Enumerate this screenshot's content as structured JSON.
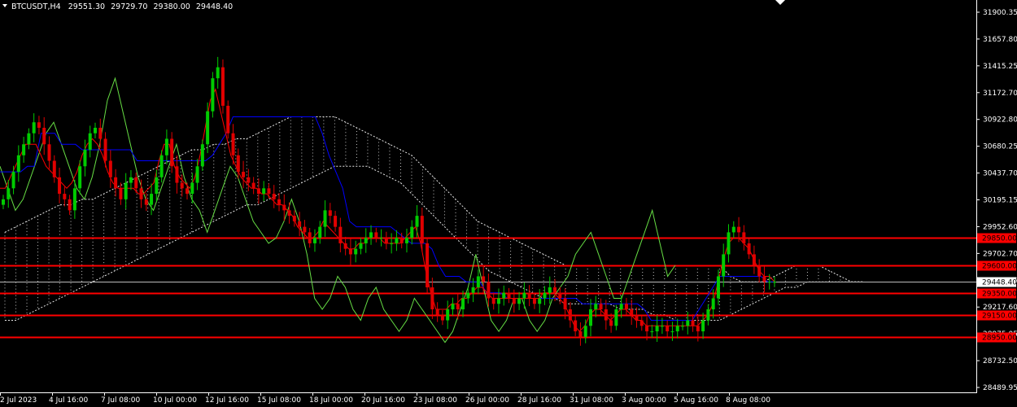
{
  "header": {
    "symbol": "BTCUSDT,H4",
    "open": "29551.30",
    "high": "29729.70",
    "low": "29380.00",
    "close": "29448.40"
  },
  "colors": {
    "background": "#000000",
    "bull_candle": "#00cc00",
    "bear_candle": "#e00000",
    "level_line": "#ff0000",
    "kijun": "#0000ff",
    "tenkan": "#ff0000",
    "chikou": "#66dd44",
    "cloud": "#e6e6e6",
    "axis": "#ffffff"
  },
  "chart_data": {
    "type": "candlestick",
    "y_ticks": [
      "31900.35",
      "31657.80",
      "31415.25",
      "31172.70",
      "30922.80",
      "30680.25",
      "30437.70",
      "30195.15",
      "29952.60",
      "29702.70",
      "29460.15",
      "29217.60",
      "28975.05",
      "28732.50",
      "28489.95"
    ],
    "ylim": [
      28489.95,
      31900.35
    ],
    "x_ticks": [
      "2 Jul 2023",
      "4 Jul 16:00",
      "7 Jul 08:00",
      "10 Jul 00:00",
      "12 Jul 16:00",
      "15 Jul 08:00",
      "18 Jul 00:00",
      "20 Jul 16:00",
      "23 Jul 08:00",
      "26 Jul 00:00",
      "28 Jul 16:00",
      "31 Jul 08:00",
      "3 Aug 00:00",
      "5 Aug 16:00",
      "8 Aug 08:00"
    ],
    "levels": [
      {
        "label": "29850.00",
        "value": 29850.0
      },
      {
        "label": "29600.00",
        "value": 29600.0
      },
      {
        "label": "29350.00",
        "value": 29350.0
      },
      {
        "label": "29150.00",
        "value": 29150.0
      },
      {
        "label": "28950.00",
        "value": 28950.0
      }
    ],
    "current_price": {
      "label": "29448.40",
      "value": 29448.4
    },
    "close_series": [
      30200,
      30300,
      30450,
      30600,
      30700,
      30800,
      30900,
      30850,
      30700,
      30550,
      30400,
      30250,
      30200,
      30100,
      30300,
      30500,
      30650,
      30800,
      30850,
      30750,
      30550,
      30400,
      30300,
      30200,
      30350,
      30400,
      30300,
      30200,
      30150,
      30250,
      30400,
      30600,
      30750,
      30500,
      30350,
      30300,
      30250,
      30350,
      30500,
      30700,
      31000,
      31300,
      31400,
      31050,
      30800,
      30600,
      30450,
      30400,
      30350,
      30300,
      30250,
      30300,
      30250,
      30200,
      30150,
      30100,
      30050,
      30000,
      29950,
      29900,
      29800,
      29850,
      29950,
      30100,
      30050,
      29950,
      29800,
      29750,
      29700,
      29750,
      29800,
      29850,
      29900,
      29850,
      29850,
      29800,
      29800,
      29850,
      29800,
      29850,
      29950,
      30050,
      29800,
      29400,
      29200,
      29150,
      29100,
      29200,
      29250,
      29200,
      29300,
      29350,
      29400,
      29500,
      29450,
      29300,
      29250,
      29300,
      29350,
      29300,
      29250,
      29300,
      29350,
      29300,
      29250,
      29300,
      29350,
      29400,
      29350,
      29300,
      29200,
      29100,
      29000,
      28950,
      29050,
      29200,
      29250,
      29200,
      29100,
      29050,
      29200,
      29250,
      29200,
      29150,
      29100,
      29050,
      29000,
      29000,
      29050,
      29050,
      29000,
      29000,
      29050,
      29050,
      29100,
      29050,
      29000,
      29100,
      29200,
      29300,
      29500,
      29700,
      29900,
      29950,
      29900,
      29800,
      29700,
      29600,
      29500,
      29450,
      29450,
      29450
    ],
    "kijun_series": [
      30450,
      30450,
      30450,
      30450,
      30500,
      30500,
      30800,
      30800,
      30800,
      30700,
      30700,
      30700,
      30650,
      30650,
      30650,
      30650,
      30650,
      30650,
      30650,
      30650,
      30550,
      30550,
      30550,
      30550,
      30550,
      30550,
      30550,
      30550,
      30550,
      30550,
      30550,
      30600,
      30700,
      30800,
      30950,
      30950,
      30950,
      30950,
      30950,
      30950,
      30950,
      30950,
      30950,
      30950,
      30950,
      30950,
      30950,
      30800,
      30600,
      30450,
      30300,
      30000,
      29950,
      29950,
      29950,
      29950,
      29950,
      29950,
      29900,
      29850,
      29800,
      29800,
      29800,
      29750,
      29600,
      29500,
      29500,
      29500,
      29450,
      29450,
      29450,
      29350,
      29350,
      29350,
      29300,
      29300,
      29300,
      29300,
      29300,
      29300,
      29300,
      29300,
      29300,
      29300,
      29300,
      29250,
      29250,
      29250,
      29250,
      29250,
      29250,
      29250,
      29250,
      29250,
      29200,
      29100,
      29100,
      29100,
      29100,
      29100,
      29100,
      29100,
      29200,
      29300,
      29400,
      29500,
      29500,
      29500,
      29500,
      29500,
      29500,
      29500,
      29450,
      29450
    ],
    "tenkan_series": [
      30300,
      30300,
      30400,
      30500,
      30600,
      30700,
      30700,
      30700,
      30600,
      30500,
      30450,
      30400,
      30350,
      30300,
      30350,
      30450,
      30600,
      30700,
      30750,
      30700,
      30600,
      30450,
      30350,
      30300,
      30300,
      30300,
      30300,
      30250,
      30250,
      30300,
      30350,
      30550,
      30700,
      30700,
      30500,
      30400,
      30350,
      30300,
      30400,
      30600,
      30850,
      31100,
      31200,
      31000,
      30800,
      30600,
      30500,
      30400,
      30350,
      30300,
      30300,
      30250,
      30250,
      30200,
      30150,
      30150,
      30100,
      30050,
      29950,
      29900,
      29850,
      29850,
      29900,
      30000,
      29950,
      29900,
      29850,
      29800,
      29750,
      29750,
      29800,
      29800,
      29850,
      29850,
      29850,
      29800,
      29800,
      29800,
      29800,
      29850,
      29900,
      29950,
      29800,
      29550,
      29350,
      29200,
      29200,
      29200,
      29250,
      29250,
      29300,
      29300,
      29350,
      29400,
      29400,
      29350,
      29300,
      29300,
      29300,
      29300,
      29300,
      29300,
      29300,
      29300,
      29300,
      29300,
      29350,
      29350,
      29350,
      29300,
      29250,
      29150,
      29050,
      29000,
      29050,
      29150,
      29200,
      29200,
      29150,
      29100,
      29150,
      29200,
      29200,
      29150,
      29100,
      29100,
      29050,
      29050,
      29050,
      29050,
      29050,
      29050,
      29050,
      29050,
      29050,
      29050,
      29050,
      29100,
      29150,
      29250,
      29450,
      29650,
      29800,
      29850,
      29850,
      29800,
      29750,
      29650,
      29550,
      29500,
      29500,
      29450
    ],
    "chikou_series": [
      30500,
      30300,
      30100,
      30200,
      30400,
      30600,
      30800,
      30900,
      30700,
      30500,
      30300,
      30200,
      30400,
      30700,
      31100,
      31300,
      31000,
      30700,
      30400,
      30200,
      30100,
      30300,
      30500,
      30700,
      30400,
      30200,
      30100,
      29900,
      30100,
      30300,
      30500,
      30400,
      30200,
      30000,
      29900,
      29800,
      29850,
      30000,
      30200,
      30000,
      29700,
      29300,
      29200,
      29300,
      29500,
      29400,
      29200,
      29100,
      29300,
      29400,
      29200,
      29100,
      29000,
      29100,
      29300,
      29200,
      29100,
      29000,
      28900,
      29000,
      29200,
      29400,
      29700,
      29400,
      29100,
      29000,
      29100,
      29300,
      29300,
      29100,
      29000,
      29100,
      29300,
      29400,
      29500,
      29700,
      29800,
      29900,
      29700,
      29500,
      29300,
      29300,
      29500,
      29700,
      29900,
      30100,
      29800,
      29500,
      29600
    ],
    "cloud_top": [
      29900,
      29950,
      30000,
      30050,
      30100,
      30150,
      30150,
      30200,
      30200,
      30250,
      30300,
      30350,
      30400,
      30450,
      30500,
      30550,
      30600,
      30650,
      30650,
      30700,
      30700,
      30750,
      30750,
      30800,
      30850,
      30900,
      30950,
      30950,
      30950,
      30950,
      30950,
      30900,
      30850,
      30800,
      30750,
      30700,
      30650,
      30600,
      30500,
      30400,
      30300,
      30200,
      30100,
      30000,
      29950,
      29900,
      29850,
      29800,
      29750,
      29700,
      29650,
      29600,
      29600,
      29600,
      29600,
      29600,
      29600,
      29600,
      29600,
      29600,
      29600,
      29600,
      29600,
      29600,
      29600,
      29600,
      29500,
      29450,
      29450,
      29450,
      29500,
      29550,
      29600,
      29600,
      29600,
      29550,
      29500,
      29450,
      29450
    ],
    "cloud_bottom": [
      29100,
      29100,
      29150,
      29200,
      29250,
      29300,
      29350,
      29400,
      29450,
      29500,
      29550,
      29600,
      29650,
      29700,
      29750,
      29800,
      29850,
      29900,
      29950,
      30000,
      30050,
      30100,
      30150,
      30150,
      30200,
      30250,
      30300,
      30350,
      30400,
      30450,
      30500,
      30500,
      30500,
      30500,
      30450,
      30400,
      30350,
      30250,
      30150,
      30050,
      29950,
      29850,
      29750,
      29650,
      29550,
      29500,
      29450,
      29400,
      29350,
      29300,
      29300,
      29250,
      29250,
      29250,
      29250,
      29250,
      29200,
      29200,
      29200,
      29150,
      29150,
      29100,
      29100,
      29100,
      29100,
      29100,
      29150,
      29200,
      29250,
      29300,
      29350,
      29400,
      29400,
      29450,
      29450,
      29450,
      29450,
      29450,
      29450
    ]
  }
}
